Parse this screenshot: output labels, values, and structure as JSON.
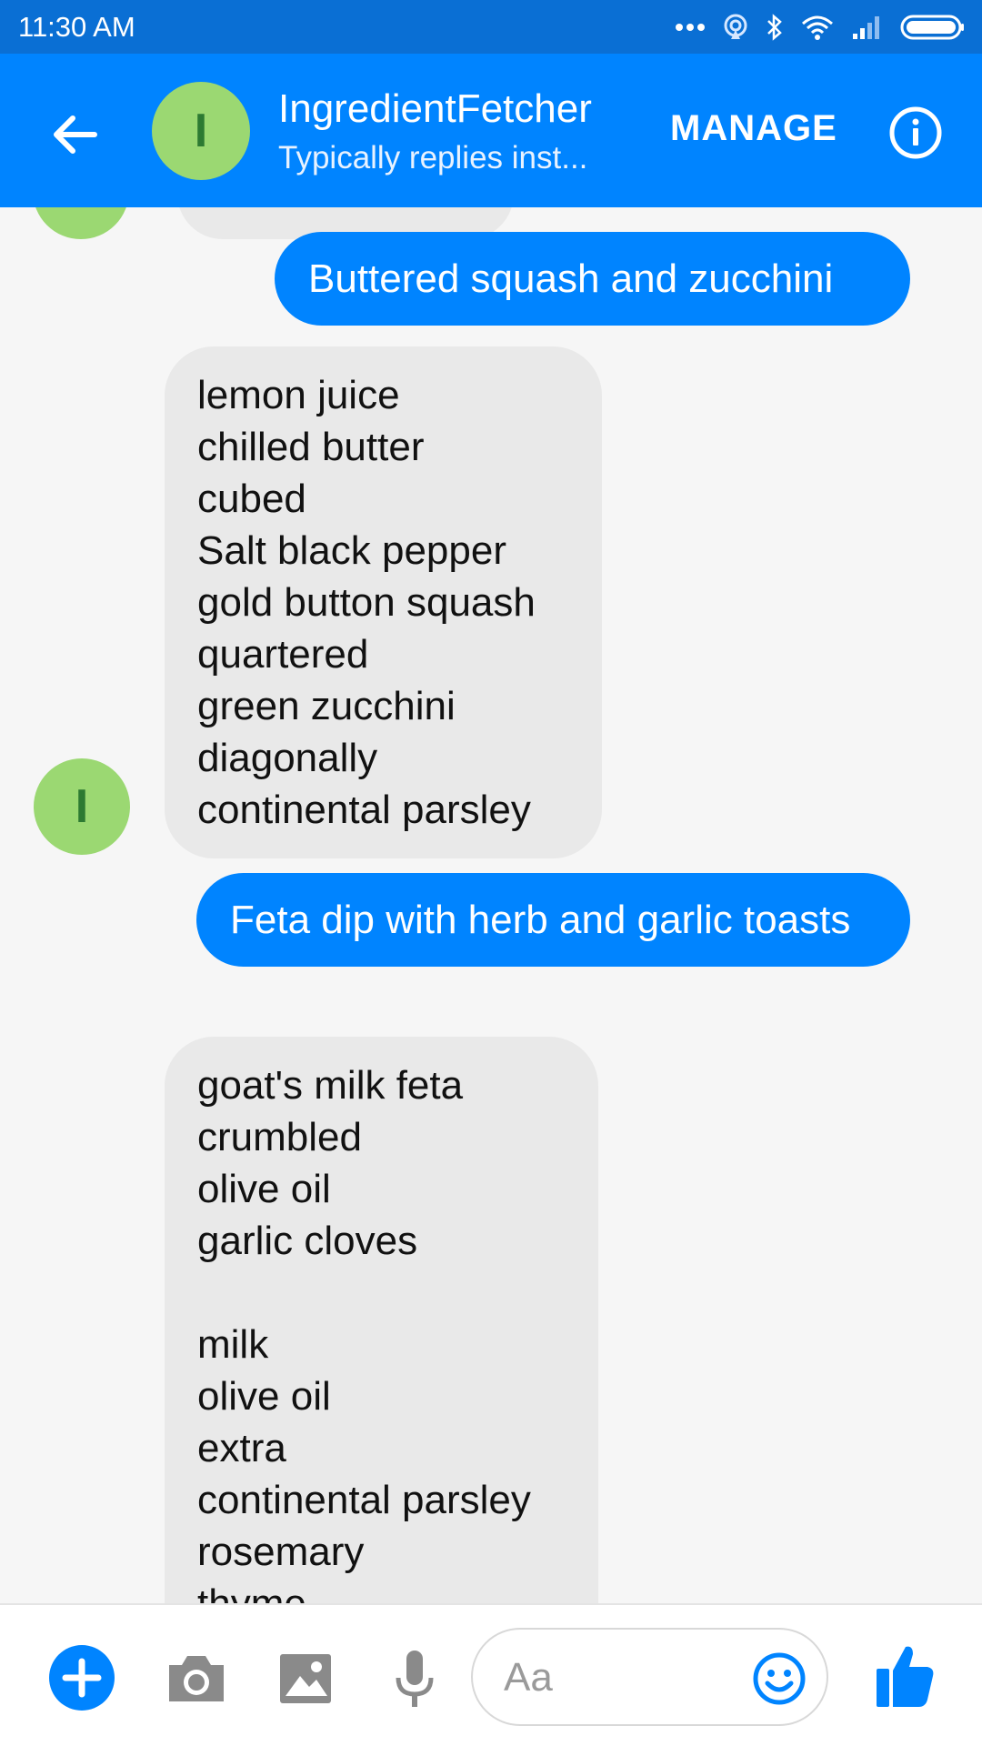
{
  "status_bar": {
    "time": "11:30 AM",
    "icons": [
      "more-dots-icon",
      "hotspot-icon",
      "bluetooth-icon",
      "wifi-icon",
      "signal-icon",
      "battery-icon"
    ]
  },
  "header": {
    "contact_name": "IngredientFetcher",
    "avatar_letter": "I",
    "subtitle": "Typically replies inst...",
    "manage_label": "MANAGE",
    "icons": [
      "back-arrow-icon",
      "info-icon"
    ]
  },
  "messages": [
    {
      "direction": "outgoing",
      "text": "Buttered squash and zucchini"
    },
    {
      "direction": "incoming",
      "text": "lemon juice\nchilled butter\ncubed\nSalt black pepper\ngold button squash\nquartered\ngreen zucchini\ndiagonally\ncontinental parsley"
    },
    {
      "direction": "outgoing",
      "text": "Feta dip with herb and garlic toasts"
    },
    {
      "direction": "incoming",
      "text": "goat's milk feta\ncrumbled\nolive oil\ngarlic cloves\n\nmilk\nolive oil\nextra\ncontinental parsley\nrosemary\nthyme"
    }
  ],
  "composer": {
    "placeholder": "Aa",
    "icons": [
      "plus-icon",
      "camera-icon",
      "image-icon",
      "microphone-icon",
      "emoji-icon",
      "thumbs-up-icon"
    ]
  },
  "colors": {
    "status_bar": "#0a6fd4",
    "header": "#0084ff",
    "outgoing_bubble": "#0084ff",
    "incoming_bubble": "#e9e9e9",
    "avatar": "#9bd872",
    "avatar_letter": "#2d7a32",
    "background": "#f6f6f6"
  }
}
